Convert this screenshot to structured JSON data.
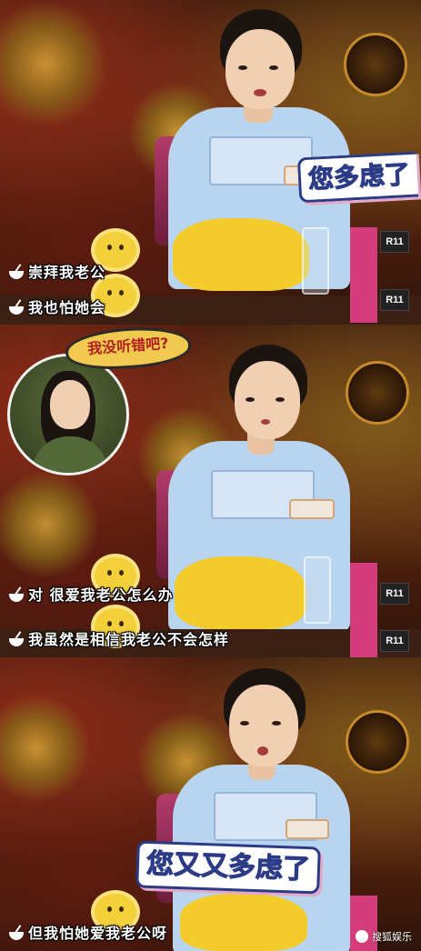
{
  "panel1": {
    "caption_big": "您多虑了",
    "subtitles": [
      "崇拜我老公",
      "我也怕她会"
    ],
    "screen_labels": [
      "R11",
      "R11"
    ]
  },
  "panel2": {
    "bubble_text": "我没听错吧?",
    "subtitles": [
      "对 很爱我老公怎么办",
      "我虽然是相信我老公不会怎样"
    ],
    "screen_labels": [
      "R11",
      "R11"
    ]
  },
  "panel3": {
    "caption_big": "您又又多虑了",
    "subtitles": [
      "但我怕她爱我老公呀"
    ],
    "watermark": "搜狐娱乐"
  },
  "colors": {
    "subtitle": "#ffffff",
    "caption_text": "#2b3b86",
    "bubble_bg": "#f0c94e",
    "bubble_text": "#b02020",
    "pink_screen": "#d43c7b"
  }
}
